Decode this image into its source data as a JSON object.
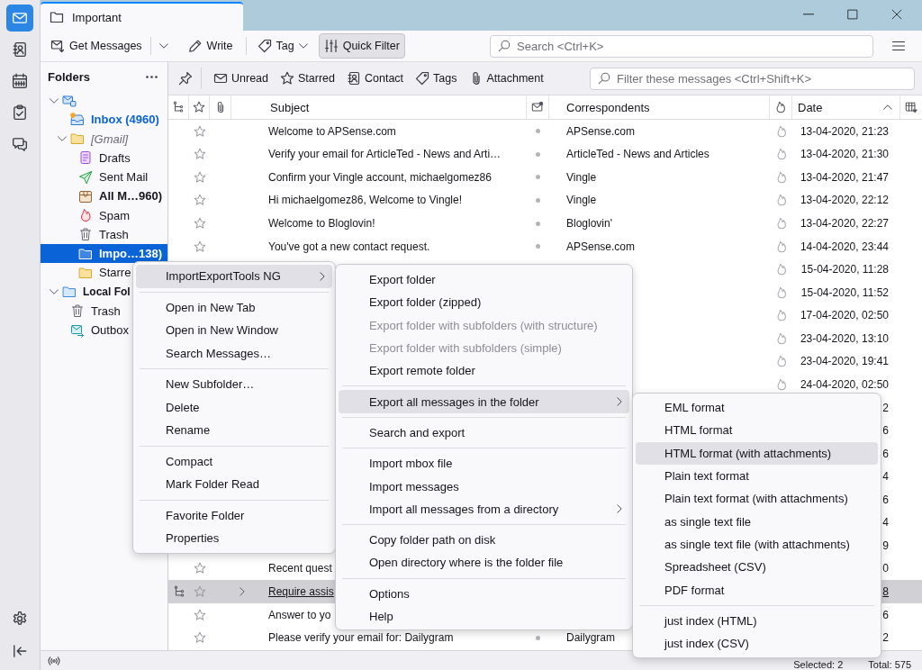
{
  "spaces_bar": {
    "items": [
      {
        "kind": "mail",
        "selected": true
      },
      {
        "kind": "address_book",
        "selected": false
      },
      {
        "kind": "calendar",
        "selected": false
      },
      {
        "kind": "tasks",
        "selected": false
      },
      {
        "kind": "chat",
        "selected": false
      }
    ],
    "bottom_items": [
      {
        "kind": "settings"
      },
      {
        "kind": "collapse"
      }
    ]
  },
  "tab": {
    "title": "Important"
  },
  "toolbar": {
    "buttons": [
      {
        "kind": "get_messages",
        "label": "Get Messages",
        "pressed": false
      },
      {
        "kind": "write",
        "label": "Write",
        "pressed": false
      },
      {
        "kind": "tag",
        "label": "Tag",
        "pressed": false
      },
      {
        "kind": "quick_filter",
        "label": "Quick Filter",
        "pressed": true
      }
    ],
    "search": {
      "placeholder": "Search <Ctrl+K>"
    }
  },
  "folder_pane": {
    "title": "Folders",
    "folders": [
      {
        "kind": "mail_account",
        "expanded": true,
        "selected": false,
        "children": [
          {
            "kind": "inbox",
            "name": "Inbox (4960)",
            "unread": true,
            "new_mail": true,
            "selected": false
          },
          {
            "kind": "virtual",
            "name": "[Gmail]",
            "expanded": true,
            "unread": false,
            "new_mail": false,
            "selected": false,
            "children": [
              {
                "kind": "drafts",
                "name": "Drafts",
                "unread": false,
                "new_mail": false,
                "selected": false
              },
              {
                "kind": "sent",
                "name": "Sent Mail",
                "unread": false,
                "new_mail": false,
                "selected": false
              },
              {
                "kind": "all_mail",
                "name": "All M…960)",
                "unread": true,
                "new_mail": false,
                "selected": false
              },
              {
                "kind": "spam",
                "name": "Spam",
                "unread": false,
                "new_mail": false,
                "selected": false
              },
              {
                "kind": "trash",
                "name": "Trash",
                "unread": false,
                "new_mail": false,
                "selected": false
              },
              {
                "kind": "folder",
                "name": "Impo…138)",
                "unread": true,
                "new_mail": false,
                "selected": true
              },
              {
                "kind": "folder",
                "name": "Starre",
                "unread": false,
                "new_mail": false,
                "selected": false
              }
            ]
          }
        ]
      },
      {
        "kind": "local_account",
        "name": "Local Fol",
        "expanded": true,
        "selected": false,
        "children": [
          {
            "kind": "trash",
            "name": "Trash",
            "unread": false,
            "new_mail": false,
            "selected": false
          },
          {
            "kind": "outbox",
            "name": "Outbox",
            "unread": false,
            "new_mail": false,
            "selected": false
          }
        ]
      }
    ]
  },
  "quick_filter": {
    "filters": [
      {
        "kind": "unread",
        "label": "Unread",
        "on": false
      },
      {
        "kind": "starred",
        "label": "Starred",
        "on": false
      },
      {
        "kind": "contact",
        "label": "Contact",
        "on": false
      },
      {
        "kind": "tags",
        "label": "Tags",
        "on": false
      },
      {
        "kind": "attachment",
        "label": "Attachment",
        "on": false
      }
    ],
    "search": {
      "placeholder": "Filter these messages <Ctrl+Shift+K>"
    }
  },
  "message_list": {
    "columns": [
      {
        "kind": "thread"
      },
      {
        "kind": "star"
      },
      {
        "kind": "attachment"
      },
      {
        "kind": "subject",
        "label": "Subject"
      },
      {
        "kind": "read"
      },
      {
        "kind": "correspondents",
        "label": "Correspondents"
      },
      {
        "kind": "junk"
      },
      {
        "kind": "date",
        "label": "Date",
        "ascending": true
      },
      {
        "kind": "picker"
      }
    ],
    "rows": [
      {
        "kind": "message",
        "subject": "Welcome to APSense.com",
        "correspondent": "APSense.com",
        "date": "13-04-2020, 21:23",
        "starred": false,
        "read": true,
        "junk": false,
        "selected": false,
        "hovered": false
      },
      {
        "kind": "message",
        "subject": "Verify your email for ArticleTed - News and Arti…",
        "correspondent": "ArticleTed - News and Articles",
        "date": "13-04-2020, 21:30",
        "starred": false,
        "read": true,
        "junk": false,
        "selected": false,
        "hovered": false
      },
      {
        "kind": "message",
        "subject": "Confirm your Vingle account, michaelgomez86",
        "correspondent": "Vingle",
        "date": "13-04-2020, 21:47",
        "starred": false,
        "read": true,
        "junk": false,
        "selected": false,
        "hovered": false
      },
      {
        "kind": "message",
        "subject": "Hi michaelgomez86, Welcome to Vingle!",
        "correspondent": "Vingle",
        "date": "13-04-2020, 22:12",
        "starred": false,
        "read": true,
        "junk": false,
        "selected": false,
        "hovered": false
      },
      {
        "kind": "message",
        "subject": "Welcome to Bloglovin!",
        "correspondent": "Bloglovin'",
        "date": "13-04-2020, 22:27",
        "starred": false,
        "read": true,
        "junk": false,
        "selected": false,
        "hovered": false
      },
      {
        "kind": "message",
        "subject": "You've got a new contact request.",
        "correspondent": "APSense.com",
        "date": "14-04-2020, 23:44",
        "starred": false,
        "read": true,
        "junk": false,
        "selected": false,
        "hovered": false
      },
      {
        "kind": "message",
        "date": "15-04-2020, 11:28",
        "junk": false,
        "selected": false,
        "hovered": false
      },
      {
        "kind": "message",
        "date": "15-04-2020, 11:52",
        "junk": false,
        "selected": false,
        "hovered": false
      },
      {
        "kind": "message",
        "date": "17-04-2020, 02:50",
        "junk": false,
        "selected": false,
        "hovered": false
      },
      {
        "kind": "message",
        "date": "23-04-2020, 13:10",
        "junk": false,
        "selected": false,
        "hovered": false
      },
      {
        "kind": "message",
        "date": "23-04-2020, 19:41",
        "junk": false,
        "selected": false,
        "hovered": false
      },
      {
        "kind": "message",
        "date": "24-04-2020, 02:50",
        "junk": false,
        "selected": false,
        "hovered": false
      },
      {
        "kind": "message",
        "date": "2",
        "selected": false,
        "hovered": false
      },
      {
        "kind": "message",
        "date": "6",
        "selected": false,
        "hovered": false
      },
      {
        "kind": "message",
        "date": "6",
        "selected": false,
        "hovered": false
      },
      {
        "kind": "message",
        "date": "4",
        "selected": false,
        "hovered": false
      },
      {
        "kind": "message",
        "date": "6",
        "selected": false,
        "hovered": false
      },
      {
        "kind": "message",
        "date": "4",
        "selected": false,
        "hovered": false
      },
      {
        "kind": "message",
        "date": "9",
        "selected": false,
        "hovered": false
      },
      {
        "kind": "message",
        "subject": "Recent quest",
        "date": "0",
        "starred": false,
        "selected": false,
        "hovered": false
      },
      {
        "kind": "thread",
        "expanded": false,
        "subject": "Require assis",
        "date": "8",
        "starred": false,
        "selected": true,
        "hovered": true
      },
      {
        "kind": "message",
        "subject": "Answer to yo",
        "date": "6",
        "starred": false,
        "selected": false,
        "hovered": false
      },
      {
        "kind": "message",
        "subject": "Please verify your email for: Dailygram",
        "correspondent": "Dailygram",
        "date": "2",
        "starred": false,
        "read": true,
        "selected": false,
        "hovered": false
      }
    ]
  },
  "menus": [
    {
      "items": [
        {
          "kind": "submenu",
          "label": "ImportExportTools NG",
          "highlighted": true
        },
        {
          "kind": "separator"
        },
        {
          "kind": "item",
          "label": "Open in New Tab",
          "highlighted": false
        },
        {
          "kind": "item",
          "label": "Open in New Window",
          "highlighted": false
        },
        {
          "kind": "item",
          "label": "Search Messages…",
          "highlighted": false
        },
        {
          "kind": "separator"
        },
        {
          "kind": "item",
          "label": "New Subfolder…",
          "highlighted": false
        },
        {
          "kind": "item",
          "label": "Delete",
          "highlighted": false
        },
        {
          "kind": "item",
          "label": "Rename",
          "highlighted": false
        },
        {
          "kind": "separator"
        },
        {
          "kind": "item",
          "label": "Compact",
          "highlighted": false
        },
        {
          "kind": "item",
          "label": "Mark Folder Read",
          "highlighted": false
        },
        {
          "kind": "separator"
        },
        {
          "kind": "item",
          "label": "Favorite Folder",
          "highlighted": false
        },
        {
          "kind": "item",
          "label": "Properties",
          "highlighted": false
        }
      ]
    },
    {
      "items": [
        {
          "kind": "item",
          "label": "Export folder",
          "highlighted": false,
          "disabled": false
        },
        {
          "kind": "item",
          "label": "Export folder (zipped)",
          "highlighted": false,
          "disabled": false
        },
        {
          "kind": "item",
          "label": "Export folder with subfolders (with structure)",
          "highlighted": false,
          "disabled": true
        },
        {
          "kind": "item",
          "label": "Export folder with subfolders (simple)",
          "highlighted": false,
          "disabled": true
        },
        {
          "kind": "item",
          "label": "Export remote folder",
          "highlighted": false,
          "disabled": false
        },
        {
          "kind": "separator"
        },
        {
          "kind": "submenu",
          "label": "Export all messages in the folder",
          "highlighted": true,
          "disabled": false
        },
        {
          "kind": "separator"
        },
        {
          "kind": "item",
          "label": "Search and export",
          "highlighted": false,
          "disabled": false
        },
        {
          "kind": "separator"
        },
        {
          "kind": "item",
          "label": "Import mbox file",
          "highlighted": false,
          "disabled": false
        },
        {
          "kind": "item",
          "label": "Import messages",
          "highlighted": false,
          "disabled": false
        },
        {
          "kind": "submenu",
          "label": "Import all messages from a directory",
          "highlighted": false,
          "disabled": false
        },
        {
          "kind": "separator"
        },
        {
          "kind": "item",
          "label": "Copy folder path on disk",
          "highlighted": false,
          "disabled": false
        },
        {
          "kind": "item",
          "label": "Open directory where is the folder file",
          "highlighted": false,
          "disabled": false
        },
        {
          "kind": "separator"
        },
        {
          "kind": "item",
          "label": "Options",
          "highlighted": false,
          "disabled": false
        },
        {
          "kind": "item",
          "label": "Help",
          "highlighted": false,
          "disabled": false
        }
      ]
    },
    {
      "items": [
        {
          "kind": "item",
          "label": "EML format",
          "highlighted": false
        },
        {
          "kind": "item",
          "label": "HTML format",
          "highlighted": false
        },
        {
          "kind": "item",
          "label": "HTML format (with attachments)",
          "highlighted": true
        },
        {
          "kind": "item",
          "label": "Plain text format",
          "highlighted": false
        },
        {
          "kind": "item",
          "label": "Plain text format (with attachments)",
          "highlighted": false
        },
        {
          "kind": "item",
          "label": "as single text file",
          "highlighted": false
        },
        {
          "kind": "item",
          "label": "as single text file (with attachments)",
          "highlighted": false
        },
        {
          "kind": "item",
          "label": "Spreadsheet (CSV)",
          "highlighted": false
        },
        {
          "kind": "item",
          "label": "PDF format",
          "highlighted": false
        },
        {
          "kind": "separator"
        },
        {
          "kind": "item",
          "label": "just index (HTML)",
          "highlighted": false
        },
        {
          "kind": "item",
          "label": "just index (CSV)",
          "highlighted": false
        }
      ]
    }
  ],
  "status_bar": {
    "selected": "Selected: 2",
    "total": "Total: 575"
  }
}
